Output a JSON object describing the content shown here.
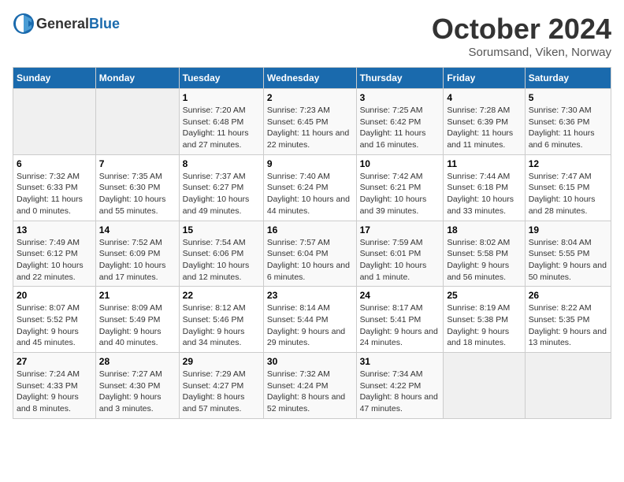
{
  "header": {
    "logo_general": "General",
    "logo_blue": "Blue",
    "month": "October 2024",
    "location": "Sorumsand, Viken, Norway"
  },
  "days_of_week": [
    "Sunday",
    "Monday",
    "Tuesday",
    "Wednesday",
    "Thursday",
    "Friday",
    "Saturday"
  ],
  "weeks": [
    [
      {
        "day": "",
        "info": ""
      },
      {
        "day": "",
        "info": ""
      },
      {
        "day": "1",
        "sunrise": "7:20 AM",
        "sunset": "6:48 PM",
        "daylight": "11 hours and 27 minutes."
      },
      {
        "day": "2",
        "sunrise": "7:23 AM",
        "sunset": "6:45 PM",
        "daylight": "11 hours and 22 minutes."
      },
      {
        "day": "3",
        "sunrise": "7:25 AM",
        "sunset": "6:42 PM",
        "daylight": "11 hours and 16 minutes."
      },
      {
        "day": "4",
        "sunrise": "7:28 AM",
        "sunset": "6:39 PM",
        "daylight": "11 hours and 11 minutes."
      },
      {
        "day": "5",
        "sunrise": "7:30 AM",
        "sunset": "6:36 PM",
        "daylight": "11 hours and 6 minutes."
      }
    ],
    [
      {
        "day": "6",
        "sunrise": "7:32 AM",
        "sunset": "6:33 PM",
        "daylight": "11 hours and 0 minutes."
      },
      {
        "day": "7",
        "sunrise": "7:35 AM",
        "sunset": "6:30 PM",
        "daylight": "10 hours and 55 minutes."
      },
      {
        "day": "8",
        "sunrise": "7:37 AM",
        "sunset": "6:27 PM",
        "daylight": "10 hours and 49 minutes."
      },
      {
        "day": "9",
        "sunrise": "7:40 AM",
        "sunset": "6:24 PM",
        "daylight": "10 hours and 44 minutes."
      },
      {
        "day": "10",
        "sunrise": "7:42 AM",
        "sunset": "6:21 PM",
        "daylight": "10 hours and 39 minutes."
      },
      {
        "day": "11",
        "sunrise": "7:44 AM",
        "sunset": "6:18 PM",
        "daylight": "10 hours and 33 minutes."
      },
      {
        "day": "12",
        "sunrise": "7:47 AM",
        "sunset": "6:15 PM",
        "daylight": "10 hours and 28 minutes."
      }
    ],
    [
      {
        "day": "13",
        "sunrise": "7:49 AM",
        "sunset": "6:12 PM",
        "daylight": "10 hours and 22 minutes."
      },
      {
        "day": "14",
        "sunrise": "7:52 AM",
        "sunset": "6:09 PM",
        "daylight": "10 hours and 17 minutes."
      },
      {
        "day": "15",
        "sunrise": "7:54 AM",
        "sunset": "6:06 PM",
        "daylight": "10 hours and 12 minutes."
      },
      {
        "day": "16",
        "sunrise": "7:57 AM",
        "sunset": "6:04 PM",
        "daylight": "10 hours and 6 minutes."
      },
      {
        "day": "17",
        "sunrise": "7:59 AM",
        "sunset": "6:01 PM",
        "daylight": "10 hours and 1 minute."
      },
      {
        "day": "18",
        "sunrise": "8:02 AM",
        "sunset": "5:58 PM",
        "daylight": "9 hours and 56 minutes."
      },
      {
        "day": "19",
        "sunrise": "8:04 AM",
        "sunset": "5:55 PM",
        "daylight": "9 hours and 50 minutes."
      }
    ],
    [
      {
        "day": "20",
        "sunrise": "8:07 AM",
        "sunset": "5:52 PM",
        "daylight": "9 hours and 45 minutes."
      },
      {
        "day": "21",
        "sunrise": "8:09 AM",
        "sunset": "5:49 PM",
        "daylight": "9 hours and 40 minutes."
      },
      {
        "day": "22",
        "sunrise": "8:12 AM",
        "sunset": "5:46 PM",
        "daylight": "9 hours and 34 minutes."
      },
      {
        "day": "23",
        "sunrise": "8:14 AM",
        "sunset": "5:44 PM",
        "daylight": "9 hours and 29 minutes."
      },
      {
        "day": "24",
        "sunrise": "8:17 AM",
        "sunset": "5:41 PM",
        "daylight": "9 hours and 24 minutes."
      },
      {
        "day": "25",
        "sunrise": "8:19 AM",
        "sunset": "5:38 PM",
        "daylight": "9 hours and 18 minutes."
      },
      {
        "day": "26",
        "sunrise": "8:22 AM",
        "sunset": "5:35 PM",
        "daylight": "9 hours and 13 minutes."
      }
    ],
    [
      {
        "day": "27",
        "sunrise": "7:24 AM",
        "sunset": "4:33 PM",
        "daylight": "9 hours and 8 minutes."
      },
      {
        "day": "28",
        "sunrise": "7:27 AM",
        "sunset": "4:30 PM",
        "daylight": "9 hours and 3 minutes."
      },
      {
        "day": "29",
        "sunrise": "7:29 AM",
        "sunset": "4:27 PM",
        "daylight": "8 hours and 57 minutes."
      },
      {
        "day": "30",
        "sunrise": "7:32 AM",
        "sunset": "4:24 PM",
        "daylight": "8 hours and 52 minutes."
      },
      {
        "day": "31",
        "sunrise": "7:34 AM",
        "sunset": "4:22 PM",
        "daylight": "8 hours and 47 minutes."
      },
      {
        "day": "",
        "info": ""
      },
      {
        "day": "",
        "info": ""
      }
    ]
  ]
}
